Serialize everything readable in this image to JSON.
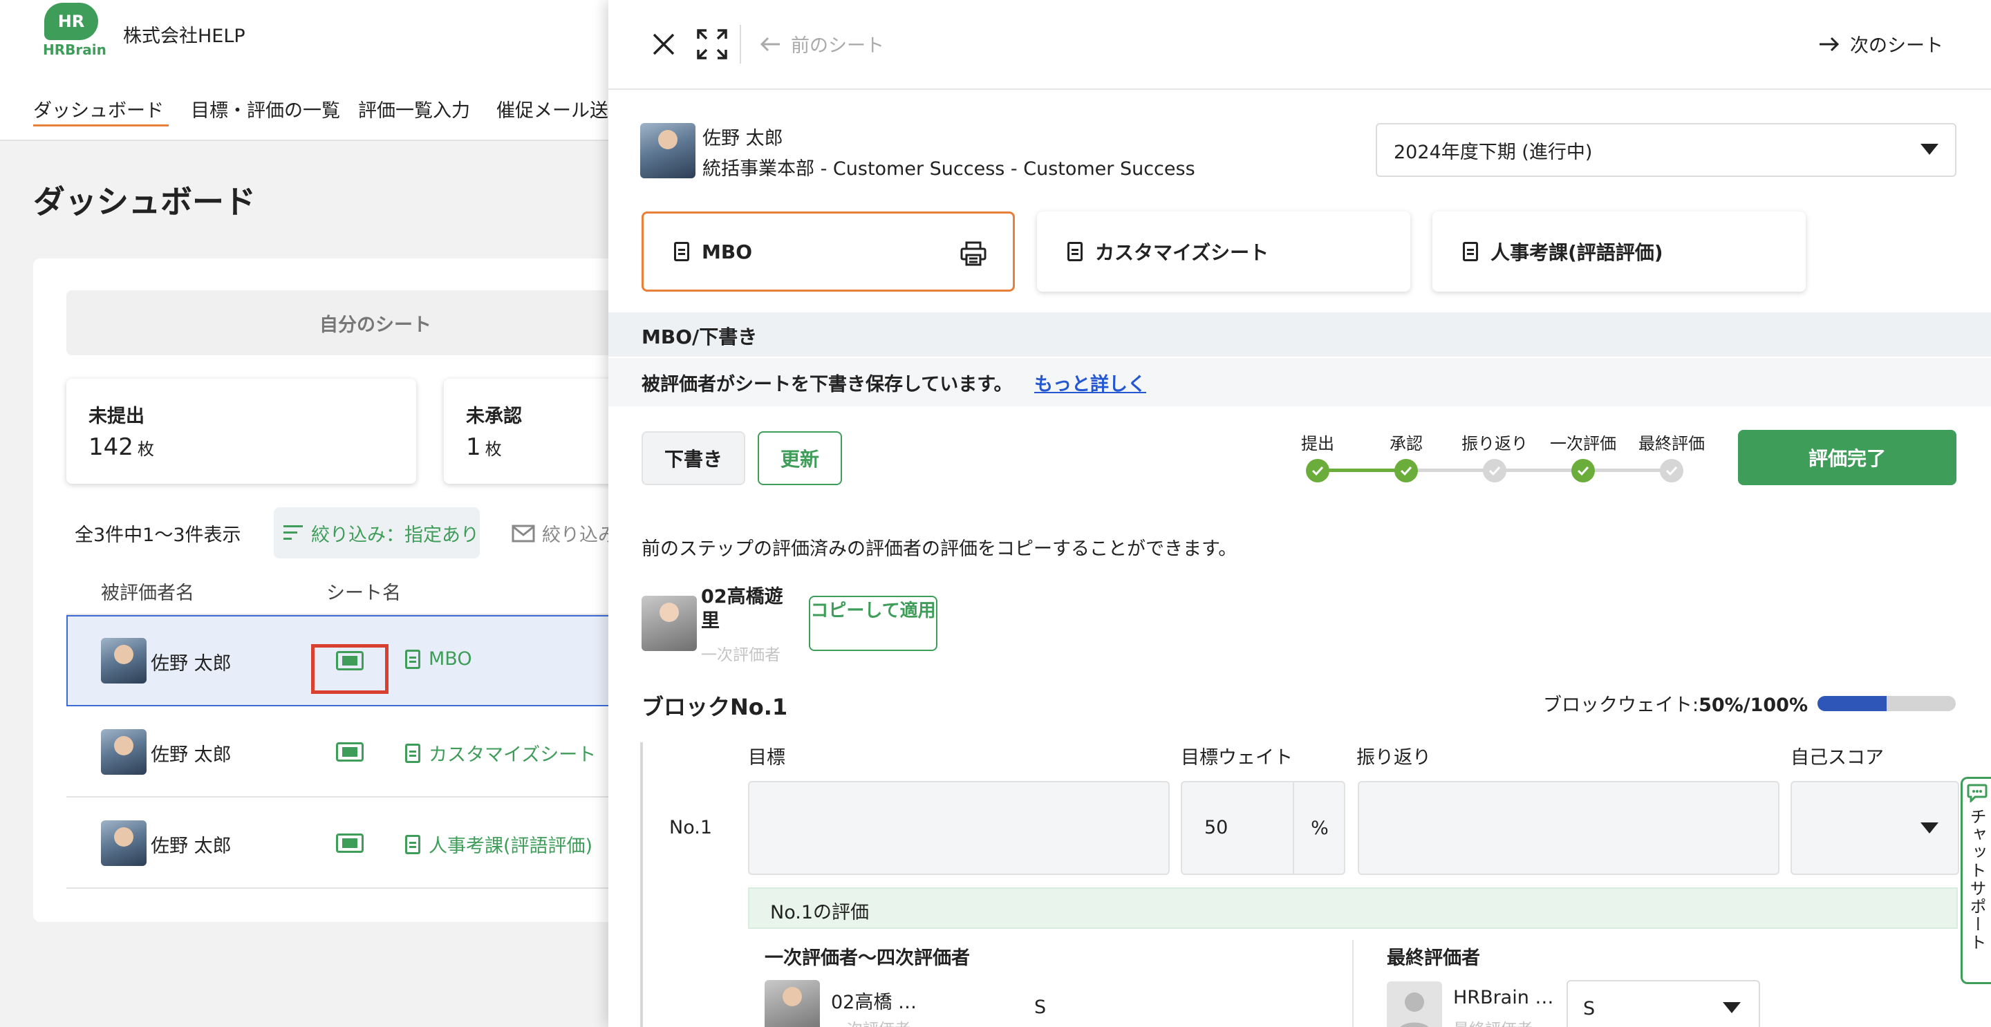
{
  "app": {
    "logo_mark": "HR",
    "logo_word": "HRBrain",
    "company": "株式会社HELP"
  },
  "nav": {
    "items": [
      "ダッシュボード",
      "目標・評価の一覧",
      "評価一覧入力",
      "催促メール送"
    ]
  },
  "dashboard": {
    "title": "ダッシュボード",
    "my_sheet_tab": "自分のシート",
    "stats": [
      {
        "label": "未提出",
        "value": "142",
        "unit": "枚"
      },
      {
        "label": "未承認",
        "value": "1",
        "unit": "枚"
      }
    ],
    "count_text": "全3件中1〜3件表示",
    "filter_label": "絞り込み：指定あり",
    "filter2_label": "絞り込み",
    "columns": [
      "被評価者名",
      "シート名"
    ],
    "rows": [
      {
        "name": "佐野 太郎",
        "sheet": "MBO"
      },
      {
        "name": "佐野 太郎",
        "sheet": "カスタマイズシート"
      },
      {
        "name": "佐野 太郎",
        "sheet": "人事考課(評語評価)"
      }
    ]
  },
  "panel": {
    "prev_sheet": "前のシート",
    "next_sheet": "次のシート",
    "user": {
      "name": "佐野 太郎",
      "dept": "統括事業本部 - Customer Success - Customer Success"
    },
    "period": "2024年度下期 (進行中)",
    "tabs": [
      "MBO",
      "カスタマイズシート",
      "人事考課(評語評価)"
    ],
    "status_title": "MBO/下書き",
    "status_msg": "被評価者がシートを下書き保存しています。",
    "status_more": "もっと詳しく",
    "draft_button": "下書き",
    "update_button": "更新",
    "steps": [
      {
        "label": "提出",
        "done": true
      },
      {
        "label": "承認",
        "done": true
      },
      {
        "label": "振り返り",
        "done": false
      },
      {
        "label": "一次評価",
        "done": true
      },
      {
        "label": "最終評価",
        "done": false
      }
    ],
    "complete_button": "評価完了",
    "copy_desc": "前のステップの評価済みの評価者の評価をコピーすることができます。",
    "evaluator": {
      "name": "02高橋遊里",
      "role": "一次評価者"
    },
    "copy_button": "コピーして適用",
    "block": {
      "title": "ブロックNo.1",
      "weight_label": "ブロックウェイト:",
      "weight_value": "50%/100%",
      "weight_fraction": 0.5,
      "columns": [
        "目標",
        "目標ウェイト",
        "振り返り",
        "自己スコア"
      ],
      "row_no": "No.1",
      "target_weight": "50",
      "weight_unit": "%"
    },
    "evaluation": {
      "title": "No.1の評価",
      "left_title": "一次評価者〜四次評価者",
      "right_title": "最終評価者",
      "first": {
        "name": "02高橋 …",
        "role": "一次評価者",
        "score": "S"
      },
      "final": {
        "name": "HRBrain …",
        "role": "最終評価者",
        "score": "S"
      }
    },
    "chat_support": "チャットサポート"
  },
  "colors": {
    "brand_green": "#3f9d5a",
    "accent_orange": "#e8803a",
    "link_blue": "#2458d3",
    "highlight_red": "#d94030"
  }
}
